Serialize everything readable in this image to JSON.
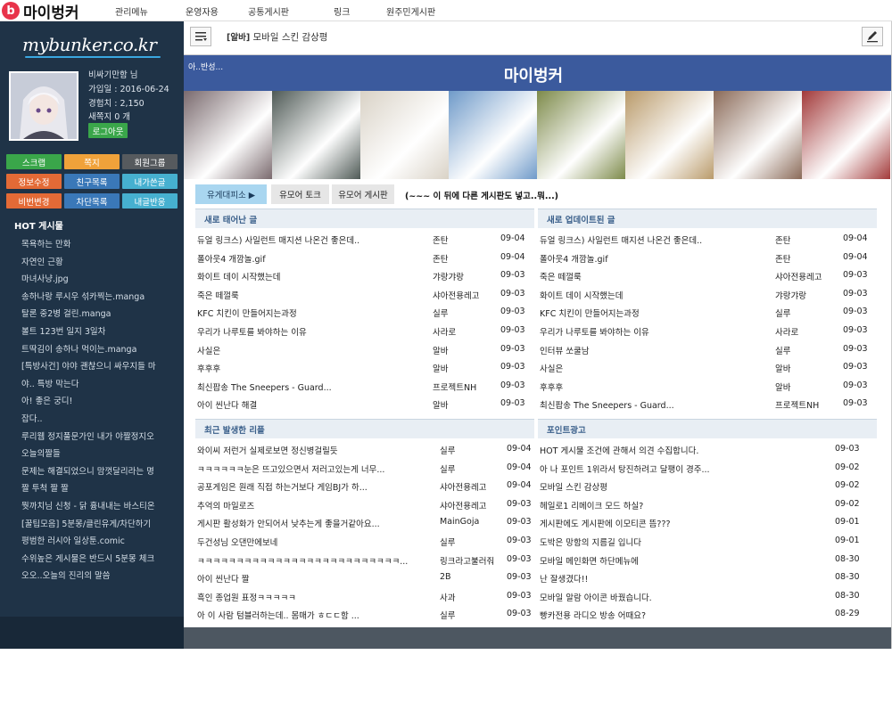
{
  "site": {
    "logo_mark": "b",
    "logo_text": "마이벙커",
    "nav": [
      "관리메뉴",
      "운영자용",
      "공통게시판",
      "링크",
      "원주민게시판"
    ],
    "brand": "mybunker.co.kr"
  },
  "profile": {
    "name": "비싸기만함 님",
    "joined": "가입일 : 2016-06-24",
    "exp": "경험치 : 2,150",
    "memo": "새쪽지 0 개",
    "logout": "로그아웃"
  },
  "side_buttons": [
    {
      "label": "스크랩",
      "color": "#3aa64a"
    },
    {
      "label": "쪽지",
      "color": "#f0a23a"
    },
    {
      "label": "회원그룹",
      "color": "#565a5e"
    },
    {
      "label": "정보수정",
      "color": "#e36a36"
    },
    {
      "label": "친구목록",
      "color": "#3a78b8"
    },
    {
      "label": "내가쓴글",
      "color": "#46b0d0"
    },
    {
      "label": "비번변경",
      "color": "#e36a36"
    },
    {
      "label": "차단목록",
      "color": "#3a78b8"
    },
    {
      "label": "내글반응",
      "color": "#46b0d0"
    }
  ],
  "hot": {
    "title": "HOT 게시물",
    "items": [
      "목욕하는 만화",
      "자연인 근황",
      "마녀사냥.jpg",
      "송하나랑 루시우 섞카찍는.manga",
      "탈론 중2병 걸린.manga",
      "볼트 123번 일지 3일차",
      "트딱김이 송하나 먹이는.manga",
      "[특방사건] 야야 괜찮으니 싸우지들 마",
      "야.. 특방 막는다",
      "아! 좋은 궁디!",
      "잡다..",
      "루리웹 정지풀문가인 내가 야짤정지오",
      "오늘의짤들",
      "문제는 해결되었으니 맘껏달리라는 명",
      "짤 투척 짤 짤",
      "뭣까치님 신청 - 닭 흉내내는 바스티온",
      "[꿀팁모음] 5분몽/클린유게/차단하기",
      "평범한 러시아 일상툰.comic",
      "수위높은 게시물은 반드시 5분몽 체크",
      "오오..오늘의 진리의 말씀"
    ]
  },
  "toolbar": {
    "crumb_tag": "[알바]",
    "crumb_title": "모바일 스킨 감상평"
  },
  "banner": {
    "small": "아..반성...",
    "title": "마이벙커"
  },
  "tabs": {
    "items": [
      "유게대피소 ▶",
      "유모어 토크",
      "유모어 게시판"
    ],
    "note": "(~~~ 이 뒤에 다른 게시판도 넣고..뭐...)"
  },
  "panels": {
    "new_posts": {
      "title": "새로 태어난 글",
      "rows": [
        [
          "듀얼 링크스) 사일런트 매지션 나온건 좋은데..",
          "존탄",
          "09-04"
        ],
        [
          "폴아웃4 개깜놀.gif",
          "존탄",
          "09-04"
        ],
        [
          "화이트 데이 시작했는데",
          "갸랑갸랑",
          "09-03"
        ],
        [
          "죽은 떼껄룩",
          "샤아전용레고",
          "09-03"
        ],
        [
          "KFC 치킨이 만들어지는과정",
          "실루",
          "09-03"
        ],
        [
          "우리가 나루토를 봐야하는 이유",
          "사라로",
          "09-03"
        ],
        [
          "사실은",
          "알바",
          "09-03"
        ],
        [
          "후후후",
          "알바",
          "09-03"
        ],
        [
          "최신팝송 The Sneepers - Guard...",
          "프로젝트NH",
          "09-03"
        ],
        [
          "아이 씬난다 해결",
          "알바",
          "09-03"
        ]
      ]
    },
    "updated_posts": {
      "title": "새로 업데이트된 글",
      "rows": [
        [
          "듀얼 링크스) 사일런트 매지션 나온건 좋은데..",
          "존탄",
          "09-04"
        ],
        [
          "폴아웃4 개깜놀.gif",
          "존탄",
          "09-04"
        ],
        [
          "죽은 떼껄룩",
          "샤아전용레고",
          "09-03"
        ],
        [
          "화이트 데이 시작했는데",
          "갸랑갸랑",
          "09-03"
        ],
        [
          "KFC 치킨이 만들어지는과정",
          "실루",
          "09-03"
        ],
        [
          "우리가 나루토를 봐야하는 이유",
          "사라로",
          "09-03"
        ],
        [
          "인터뷰 쏘쿨남",
          "실루",
          "09-03"
        ],
        [
          "사실은",
          "알바",
          "09-03"
        ],
        [
          "후후후",
          "알바",
          "09-03"
        ],
        [
          "최신팝송 The Sneepers - Guard...",
          "프로젝트NH",
          "09-03"
        ]
      ]
    },
    "recent_replies": {
      "title": "최근 발생한 리플",
      "rows": [
        [
          "와이씨 저런거 실제로보면 정신병걸릴듯",
          "실루",
          "09-04"
        ],
        [
          "ㅋㅋㅋㅋㅋㅋ눈은 뜨고있으면서 저러고있는게 너무...",
          "실루",
          "09-04"
        ],
        [
          "공포게임은 원래 직접 하는거보다 게임BJ가 하...",
          "샤아전용레고",
          "09-04"
        ],
        [
          "추억의 마일로즈",
          "샤아전용레고",
          "09-03"
        ],
        [
          "게시판 활성화가 안되어서 낮추는게 좋을거같아요...",
          "MainGoja",
          "09-03"
        ],
        [
          "두건성님 오댄만에보네",
          "실루",
          "09-03"
        ],
        [
          "ㅋㅋㅋㅋㅋㅋㅋㅋㅋㅋㅋㅋㅋㅋㅋㅋㅋㅋㅋㅋㅋㅋㅋㅋㅋㅋ...",
          "링크라고불러줘",
          "09-03"
        ],
        [
          "아이 씬난다 짤",
          "2B",
          "09-03"
        ],
        [
          "흑인 종업원 표정ㅋㅋㅋㅋㅋ",
          "사과",
          "09-03"
        ],
        [
          "아 이 사람 텀블러하는데.. 몸매가 ㅎㄷㄷ함 ...",
          "실루",
          "09-03"
        ]
      ]
    },
    "point_ads": {
      "title": "포인트광고",
      "rows": [
        [
          "HOT 게시물 조건에 관해서 의견 수집합니다.",
          "09-03"
        ],
        [
          "아 나 포인트 1위라서 탕진하려고 달팽이 경주...",
          "09-02"
        ],
        [
          "모바일 스킨 감상평",
          "09-02"
        ],
        [
          "헤일로1 리메이크 모드 하실?",
          "09-02"
        ],
        [
          "게시판에도 게시판에 이모티콘 뜸???",
          "09-01"
        ],
        [
          "도박은 망함의 지름길 입니다",
          "09-01"
        ],
        [
          "모바일 메인화면 하단메뉴에",
          "08-30"
        ],
        [
          "난 잘생겼다!!",
          "08-30"
        ],
        [
          "모바일 알람 아이콘 바꿨습니다.",
          "08-30"
        ],
        [
          "빵카전용 라디오 방송 어때요?",
          "08-29"
        ]
      ]
    }
  },
  "photo_colors": [
    "#7a6a6e",
    "#4f5a56",
    "#d9d2c6",
    "#6f9ac9",
    "#7d8a4a",
    "#b99a6a",
    "#8a6a58",
    "#a23a3a"
  ]
}
